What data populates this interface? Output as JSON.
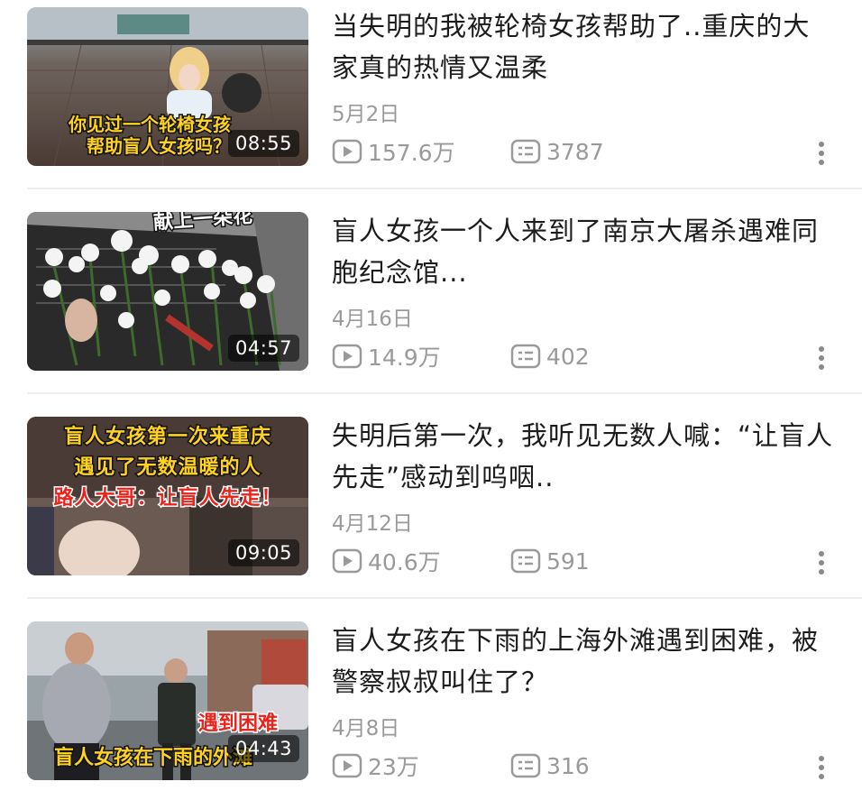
{
  "videos": [
    {
      "title": "当失明的我被轮椅女孩帮助了..重庆的大家真的热情又温柔",
      "duration": "08:55",
      "date": "5月2日",
      "views": "157.6万",
      "comments": "3787",
      "thumb_caption": [
        "你见过一个轮椅女孩",
        "帮助盲人女孩吗？"
      ]
    },
    {
      "title": "盲人女孩一个人来到了南京大屠杀遇难同胞纪念馆...",
      "duration": "04:57",
      "date": "4月16日",
      "views": "14.9万",
      "comments": "402",
      "thumb_caption": [
        "献上一朵花"
      ]
    },
    {
      "title": "失明后第一次，我听见无数人喊：“让盲人先走”感动到呜咽..",
      "duration": "09:05",
      "date": "4月12日",
      "views": "40.6万",
      "comments": "591",
      "thumb_caption": [
        "盲人女孩第一次来重庆",
        "遇见了无数温暖的人",
        "路人大哥：让盲人先走！"
      ]
    },
    {
      "title": "盲人女孩在下雨的上海外滩遇到困难，被警察叔叔叫住了？",
      "duration": "04:43",
      "date": "4月8日",
      "views": "23万",
      "comments": "316",
      "thumb_caption": [
        "遇到困难",
        "盲人女孩在下雨的外滩"
      ]
    }
  ],
  "icons": {
    "play": "play-count-icon",
    "comment": "danmaku-comment-icon",
    "more": "more-vertical-icon"
  },
  "colors": {
    "meta": "#9a9a9a",
    "title": "#1c1c1c",
    "caption_yellow": "#ffd21f",
    "caption_red": "#e8231b"
  }
}
